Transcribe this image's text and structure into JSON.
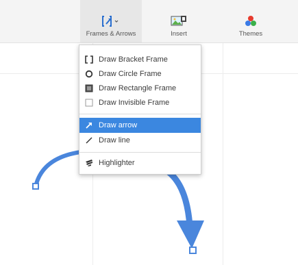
{
  "toolbar": {
    "frames_arrows_label": "Frames & Arrows",
    "insert_label": "Insert",
    "themes_label": "Themes"
  },
  "menu": {
    "draw_bracket_frame": "Draw Bracket Frame",
    "draw_circle_frame": "Draw Circle Frame",
    "draw_rectangle_frame": "Draw Rectangle Frame",
    "draw_invisible_frame": "Draw Invisible Frame",
    "draw_arrow": "Draw arrow",
    "draw_line": "Draw line",
    "highlighter": "Highlighter"
  },
  "colors": {
    "accent_blue": "#3b87e0",
    "arrow_blue": "#4a86dc"
  }
}
